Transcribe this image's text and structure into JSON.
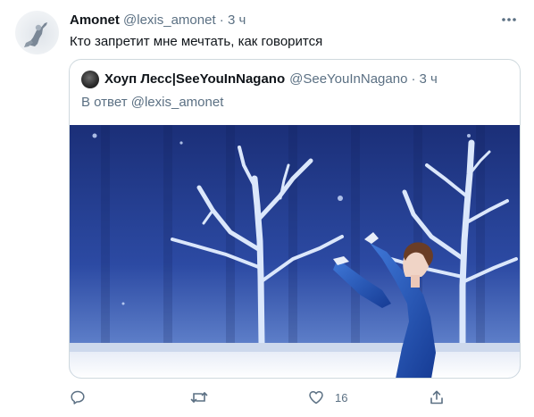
{
  "author": {
    "name": "Amonet",
    "handle": "@lexis_amonet",
    "separator": "·",
    "time": "3 ч"
  },
  "tweet": {
    "text": "Кто запретит мне мечтать, как говорится"
  },
  "quoted": {
    "name": "Хоуп Лесс|SeeYouInNagano",
    "handle": "@SeeYouInNagano",
    "separator": "·",
    "time": "3 ч",
    "reply_prefix": "В ответ",
    "reply_to": "@lexis_amonet"
  },
  "actions": {
    "reply": "",
    "retweet": "",
    "like_count": "16",
    "share": ""
  },
  "colors": {
    "text_primary": "#0f1419",
    "text_secondary": "#5b7083",
    "border": "#cfd9de",
    "photo_backdrop": "#213a8a"
  },
  "icons": {
    "more": "more-horizontal-icon",
    "reply": "reply-icon",
    "retweet": "retweet-icon",
    "like": "heart-icon",
    "share": "share-icon"
  }
}
